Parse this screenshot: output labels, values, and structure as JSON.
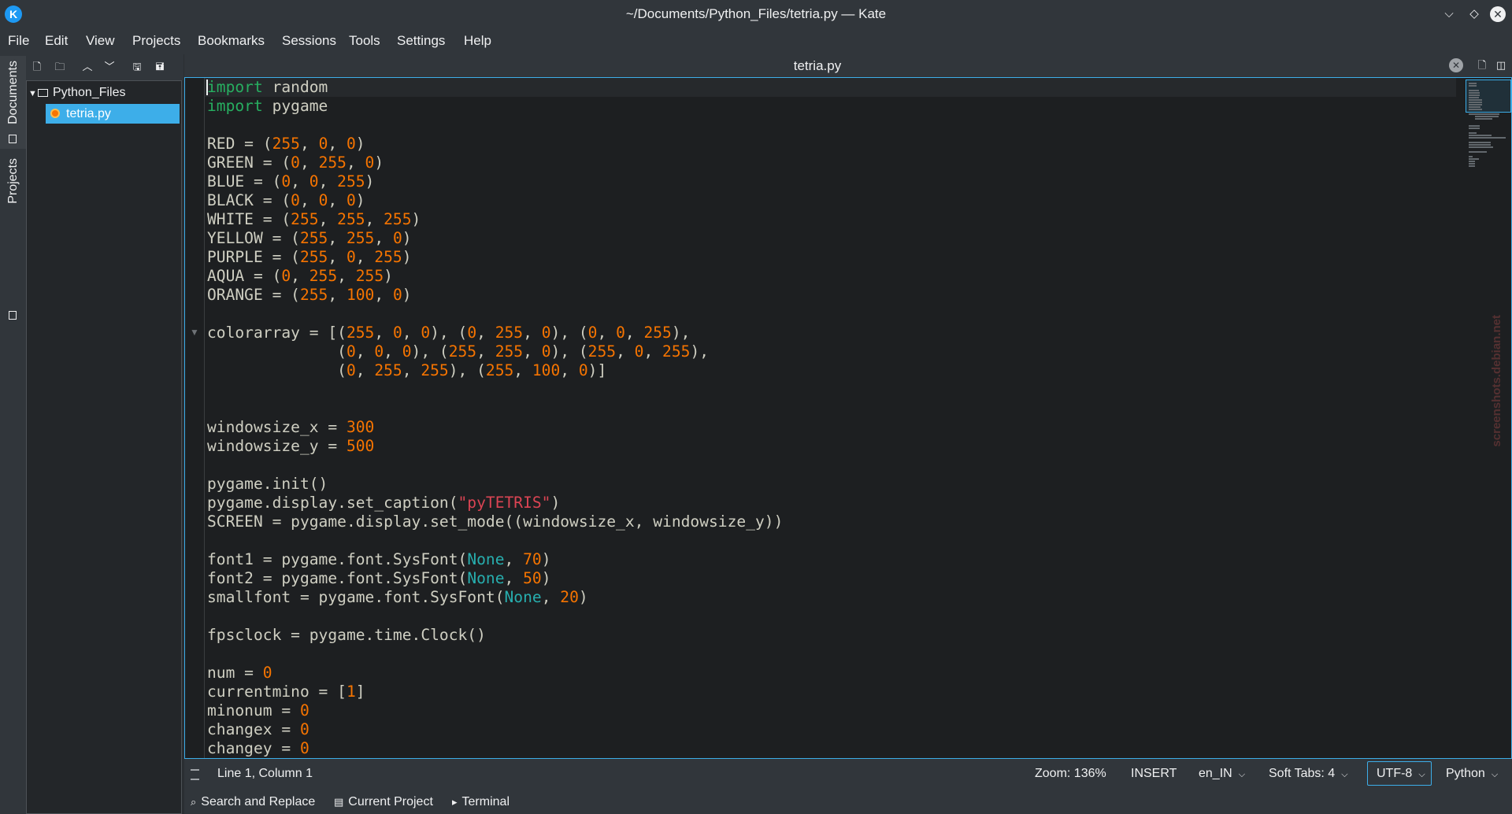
{
  "window": {
    "title": "~/Documents/Python_Files/tetria.py — Kate",
    "logo_glyph": "K",
    "controls": {
      "minimize": "⌵",
      "maximize": "◇",
      "close": "✕"
    }
  },
  "menu": {
    "items": [
      "File",
      "Edit",
      "View",
      "Projects",
      "Bookmarks",
      "Sessions",
      "Tools",
      "Settings",
      "Help"
    ]
  },
  "side_tabs": [
    {
      "label": "Documents",
      "icon": "document-icon",
      "active": true
    },
    {
      "label": "Projects",
      "icon": "project-icon",
      "active": false
    }
  ],
  "tree_toolbar": {
    "icons": [
      "new-file-icon",
      "open-folder-icon",
      "up-icon",
      "down-icon",
      "save-icon",
      "save-all-icon"
    ]
  },
  "tree": {
    "folder": "Python_Files",
    "file": "tetria.py"
  },
  "editor": {
    "tab_title": "tetria.py",
    "lines": [
      "import random",
      "import pygame",
      "",
      "RED = (255, 0, 0)",
      "GREEN = (0, 255, 0)",
      "BLUE = (0, 0, 255)",
      "BLACK = (0, 0, 0)",
      "WHITE = (255, 255, 255)",
      "YELLOW = (255, 255, 0)",
      "PURPLE = (255, 0, 255)",
      "AQUA = (0, 255, 255)",
      "ORANGE = (255, 100, 0)",
      "",
      "colorarray = [(255, 0, 0), (0, 255, 0), (0, 0, 255),",
      "              (0, 0, 0), (255, 255, 0), (255, 0, 255),",
      "              (0, 255, 255), (255, 100, 0)]",
      "",
      "",
      "windowsize_x = 300",
      "windowsize_y = 500",
      "",
      "pygame.init()",
      "pygame.display.set_caption(\"pyTETRIS\")",
      "SCREEN = pygame.display.set_mode((windowsize_x, windowsize_y))",
      "",
      "font1 = pygame.font.SysFont(None, 70)",
      "font2 = pygame.font.SysFont(None, 50)",
      "smallfont = pygame.font.SysFont(None, 20)",
      "",
      "fpsclock = pygame.time.Clock()",
      "",
      "num = 0",
      "currentmino = [1]",
      "minonum = 0",
      "changex = 0",
      "changey = 0"
    ]
  },
  "status": {
    "cursor_position": "Line 1, Column 1",
    "zoom": "Zoom: 136%",
    "mode": "INSERT",
    "language_dict": "en_IN",
    "indentation": "Soft Tabs: 4",
    "encoding": "UTF-8",
    "syntax": "Python"
  },
  "bottom_tools": {
    "search": "Search and Replace",
    "project": "Current Project",
    "terminal": "Terminal"
  },
  "watermark": "screenshots.debian.net",
  "colors": {
    "accent": "#3daee9",
    "keyword": "#27ae60",
    "number": "#f67400",
    "string": "#da4453",
    "none_const": "#27aeae",
    "background": "#1d1f21"
  }
}
